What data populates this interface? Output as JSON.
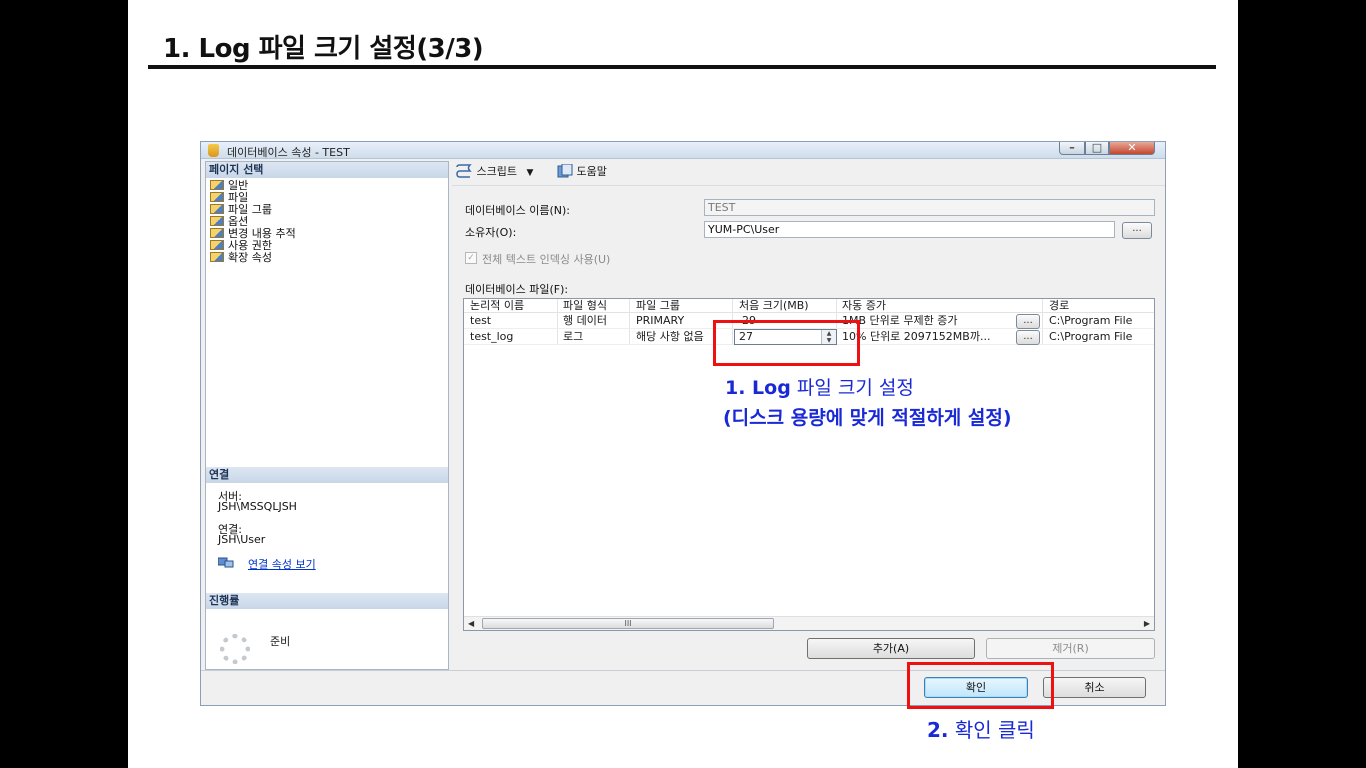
{
  "slide": {
    "title": "1. Log 파일 크기 설정(3/3)"
  },
  "dialog": {
    "window_title": "데이터베이스 속성 - TEST",
    "left_pane": {
      "page_select_header": "페이지 선택",
      "pages": [
        "일반",
        "파일",
        "파일 그룹",
        "옵션",
        "변경 내용 추적",
        "사용 권한",
        "확장 속성"
      ],
      "connection_header": "연결",
      "server_label": "서버:",
      "server_value": "JSH\\MSSQLJSH",
      "conn_label": "연결:",
      "conn_value": "JSH\\User",
      "view_conn_props": "연결 속성 보기",
      "progress_header": "진행률",
      "progress_status": "준비"
    },
    "toolbar": {
      "script_label": "스크립트",
      "help_label": "도움말"
    },
    "form": {
      "db_name_label": "데이터베이스 이름(N):",
      "db_name_value": "TEST",
      "owner_label": "소유자(O):",
      "owner_value": "YUM-PC\\User",
      "owner_browse": "...",
      "fulltext_label": "전체 텍스트 인덱싱 사용(U)",
      "db_files_label": "데이터베이스 파일(F):"
    },
    "files_grid": {
      "columns": [
        "논리적 이름",
        "파일 형식",
        "파일 그룹",
        "처음 크기(MB)",
        "자동 증가",
        "경로"
      ],
      "rows": [
        {
          "name": "test",
          "type": "행 데이터",
          "group": "PRIMARY",
          "size": "29",
          "autogrowth": "1MB 단위로 무제한 증가",
          "browse": "...",
          "path": "C:\\Program File"
        },
        {
          "name": "test_log",
          "type": "로그",
          "group": "해당 사항 없음",
          "size": "27",
          "autogrowth": "10% 단위로 2097152MB까...",
          "browse": "...",
          "path": "C:\\Program File"
        }
      ],
      "scroll_thumb": "III"
    },
    "buttons": {
      "add": "추가(A)",
      "remove": "제거(R)",
      "ok": "확인",
      "cancel": "취소"
    }
  },
  "annotations": {
    "note1_prefix": "1. Log",
    "note1_rest": " 파일 크기 설정",
    "note1_line2": "(디스크 용량에 맞게 적절하게 설정)",
    "note2_prefix": "2.",
    "note2_rest": " 확인 클릭"
  },
  "colors": {
    "annotation": "#1a29d6",
    "highlight_box": "#ee1111"
  }
}
